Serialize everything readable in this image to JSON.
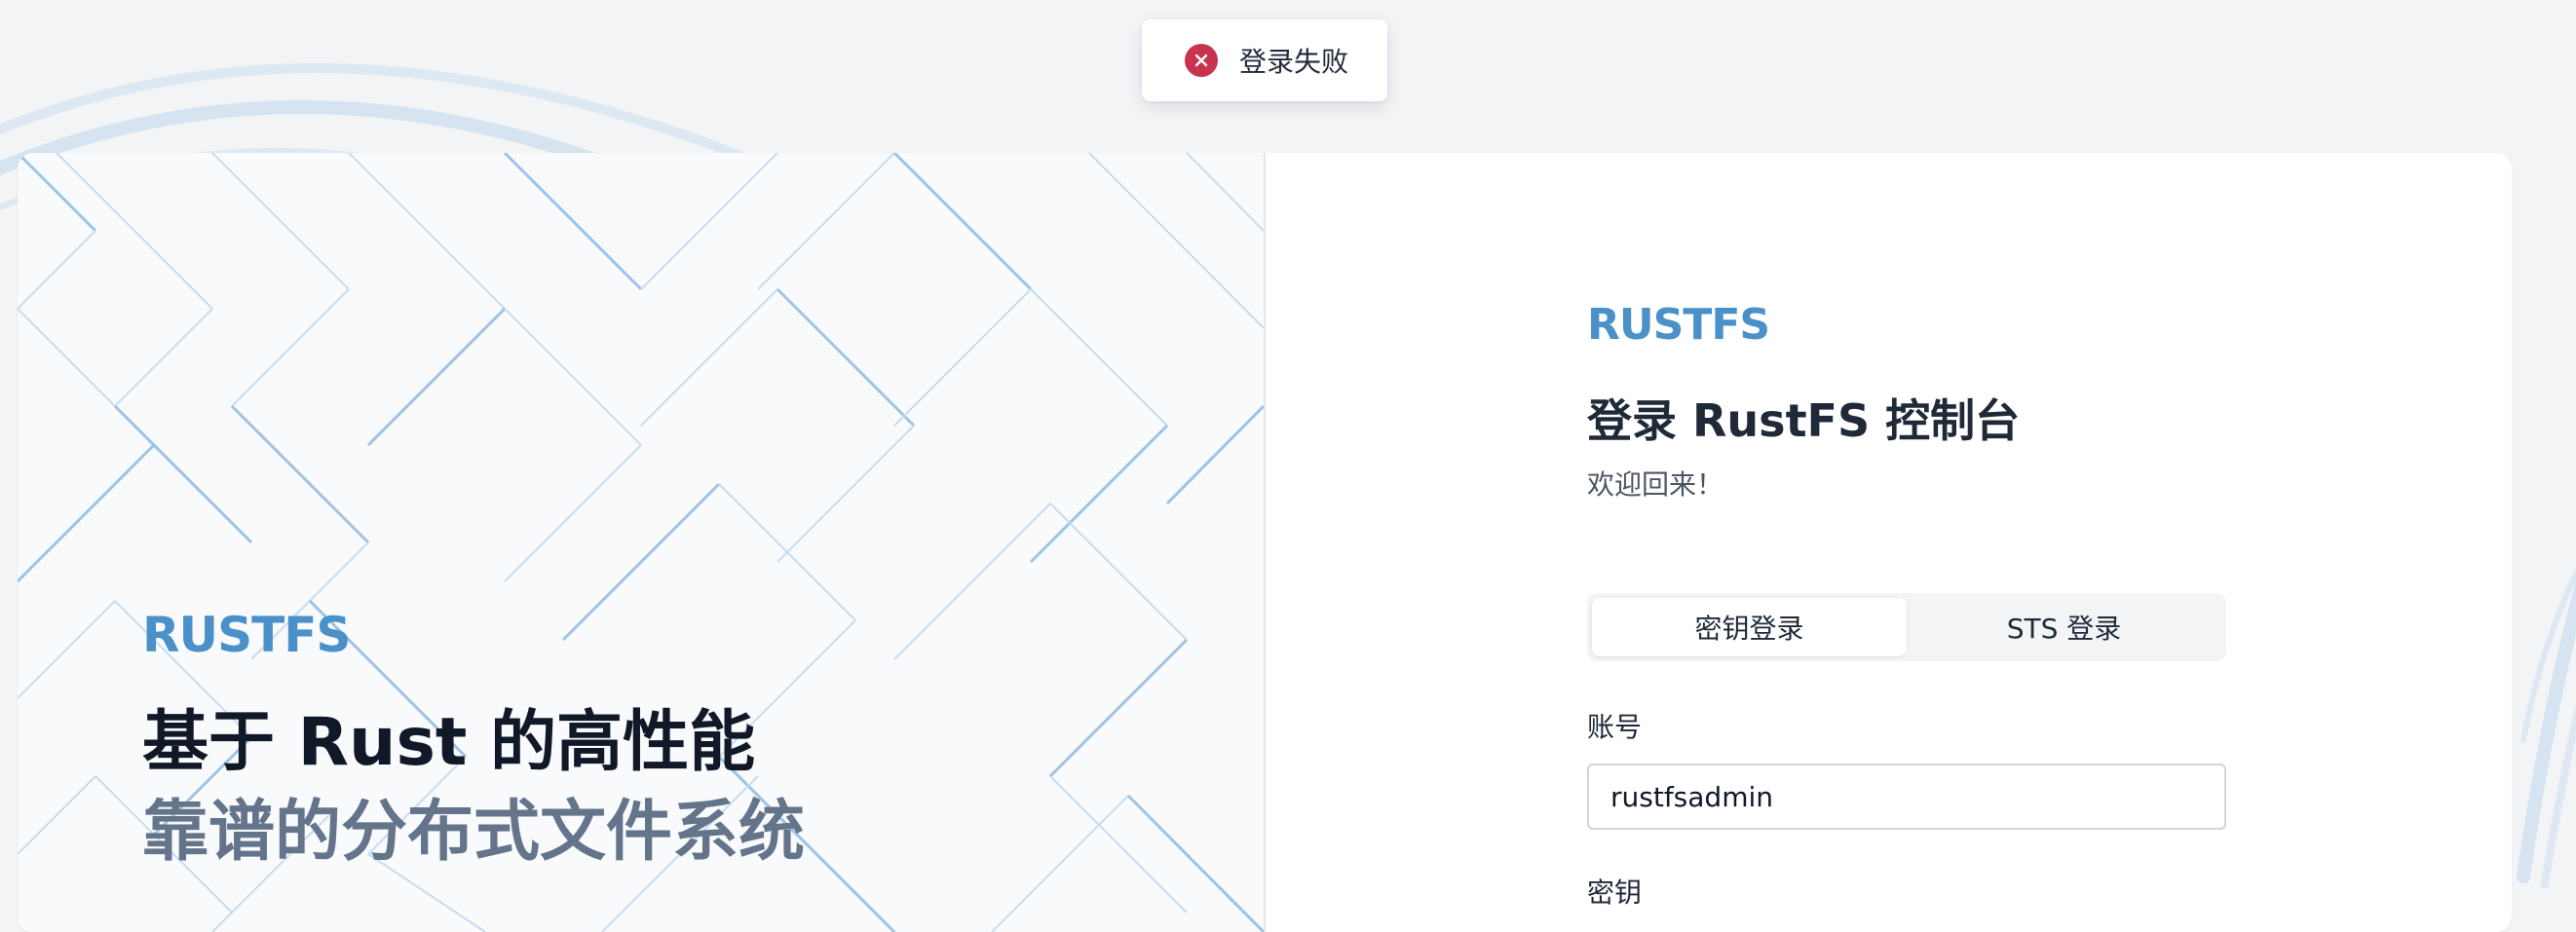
{
  "toast": {
    "message": "登录失败",
    "icon": "error-circle-icon",
    "color": "#c8334d"
  },
  "hero": {
    "brand": "RUSTFS",
    "headline": "基于 Rust 的高性能",
    "subheadline": "靠谱的分布式文件系统"
  },
  "login": {
    "brand": "RUSTFS",
    "title": "登录 RustFS 控制台",
    "welcome": "欢迎回来！",
    "settings_icon": "gear-icon",
    "tabs": [
      {
        "label": "密钥登录",
        "active": true
      },
      {
        "label": "STS 登录",
        "active": false
      }
    ],
    "account_label": "账号",
    "account_value": "rustfsadmin",
    "secret_label": "密钥"
  },
  "colors": {
    "brand": "#4a90c9",
    "page_bg": "#f3f4f6",
    "left_panel_bg": "#f8fafc"
  }
}
